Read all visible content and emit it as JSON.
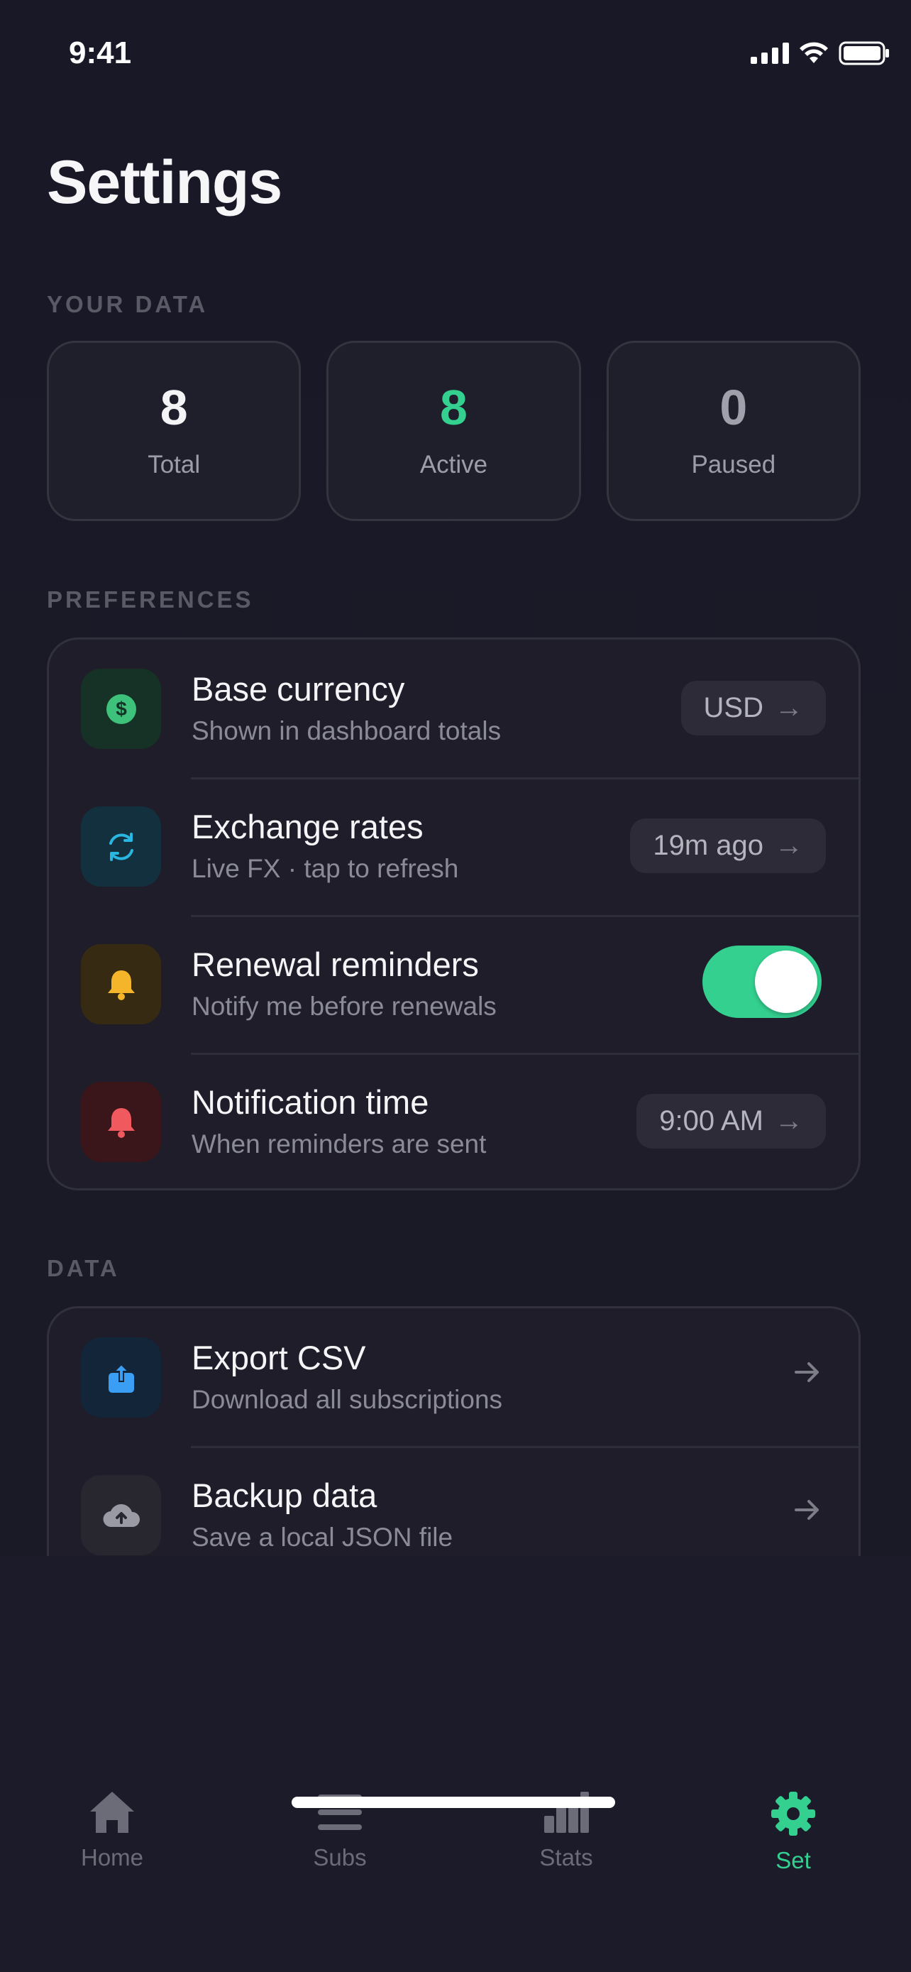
{
  "status": {
    "time": "9:41"
  },
  "page": {
    "title": "Settings"
  },
  "your_data": {
    "label": "YOUR DATA",
    "stats": [
      {
        "value": "8",
        "label": "Total"
      },
      {
        "value": "8",
        "label": "Active"
      },
      {
        "value": "0",
        "label": "Paused"
      }
    ]
  },
  "preferences": {
    "label": "PREFERENCES",
    "rows": [
      {
        "title": "Base currency",
        "subtitle": "Shown in dashboard totals",
        "value": "USD",
        "icon": "dollar-icon",
        "color": "#3ec17b"
      },
      {
        "title": "Exchange rates",
        "subtitle": "Live FX · tap to refresh",
        "value": "19m ago",
        "icon": "refresh-icon",
        "color": "#29b6e0"
      },
      {
        "title": "Renewal reminders",
        "subtitle": "Notify me before renewals",
        "toggle_on": true,
        "icon": "bell-icon",
        "color": "#f5b52a"
      },
      {
        "title": "Notification time",
        "subtitle": "When reminders are sent",
        "value": "9:00 AM",
        "icon": "bell-icon",
        "color": "#f05a5f"
      }
    ]
  },
  "data_section": {
    "label": "DATA",
    "rows": [
      {
        "title": "Export CSV",
        "subtitle": "Download all subscriptions",
        "icon": "share-icon",
        "color": "#3b9ef5"
      },
      {
        "title": "Backup data",
        "subtitle": "Save a local JSON file",
        "icon": "cloud-upload-icon",
        "color": "#9a9aa4"
      }
    ]
  },
  "tabs": [
    {
      "label": "Home",
      "icon": "home-icon",
      "active": false
    },
    {
      "label": "Subs",
      "icon": "list-icon",
      "active": false
    },
    {
      "label": "Stats",
      "icon": "chart-icon",
      "active": false
    },
    {
      "label": "Set",
      "icon": "gear-icon",
      "active": true
    }
  ],
  "colors": {
    "accent": "#33d090",
    "background": "#1b1a27"
  }
}
